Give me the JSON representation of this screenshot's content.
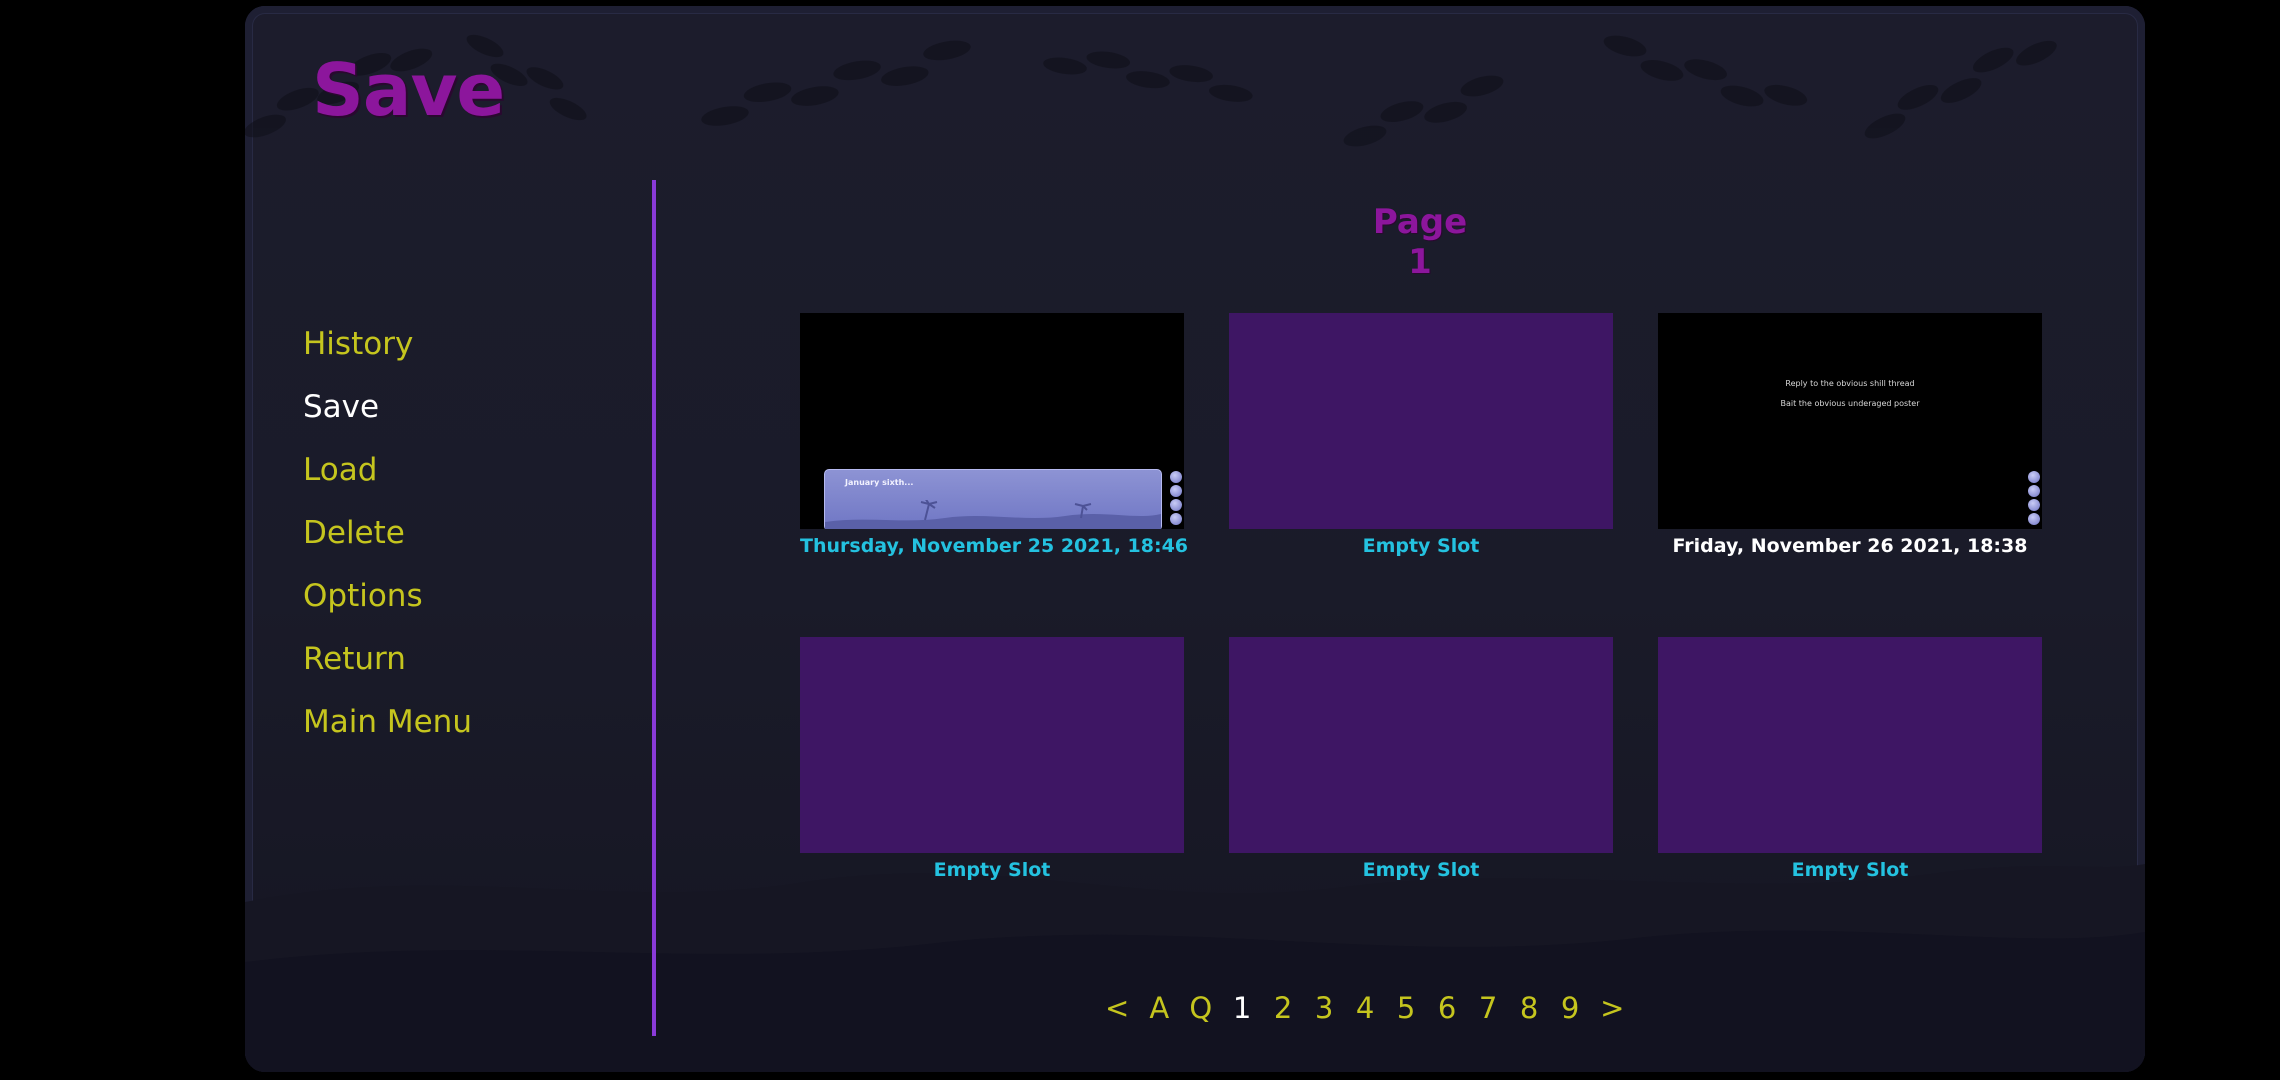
{
  "screen": {
    "title": "Save"
  },
  "nav": {
    "items": [
      {
        "label": "History",
        "active": false
      },
      {
        "label": "Save",
        "active": true
      },
      {
        "label": "Load",
        "active": false
      },
      {
        "label": "Delete",
        "active": false
      },
      {
        "label": "Options",
        "active": false
      },
      {
        "label": "Return",
        "active": false
      },
      {
        "label": "Main Menu",
        "active": false
      }
    ]
  },
  "page": {
    "title": "Page 1"
  },
  "slots": [
    {
      "label": "Thursday, November 25 2021, 18:46",
      "empty": false,
      "thumbnail": {
        "speaker": "January sixth..."
      }
    },
    {
      "label": "Empty Slot",
      "empty": true
    },
    {
      "label": "Friday, November 26 2021, 18:38",
      "empty": false,
      "thumbnail": {
        "choices": [
          "Reply to the obvious shill thread",
          "Bait the obvious underaged poster"
        ]
      }
    },
    {
      "label": "Empty Slot",
      "empty": true
    },
    {
      "label": "Empty Slot",
      "empty": true
    },
    {
      "label": "Empty Slot",
      "empty": true
    }
  ],
  "pager": {
    "prev": "<",
    "auto": "A",
    "quick": "Q",
    "pages": [
      "1",
      "2",
      "3",
      "4",
      "5",
      "6",
      "7",
      "8",
      "9"
    ],
    "active_page": "1",
    "next": ">"
  },
  "colors": {
    "title": "#8c169c",
    "menu_idle": "#c5c51e",
    "menu_active": "#ffffff",
    "divider": "#8a3ad8",
    "empty_slot": "#3e1664",
    "slot_label": "#24c2e0"
  }
}
